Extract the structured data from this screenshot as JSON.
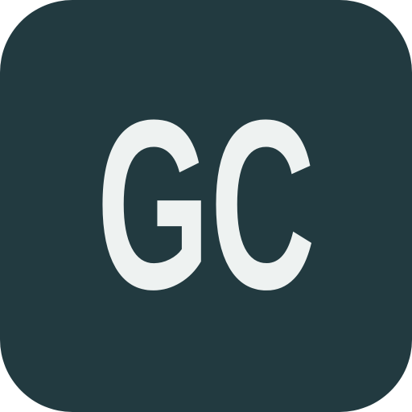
{
  "icon": {
    "monogram": "GC",
    "background_color": "#223a40",
    "text_color": "#eef2f1"
  }
}
